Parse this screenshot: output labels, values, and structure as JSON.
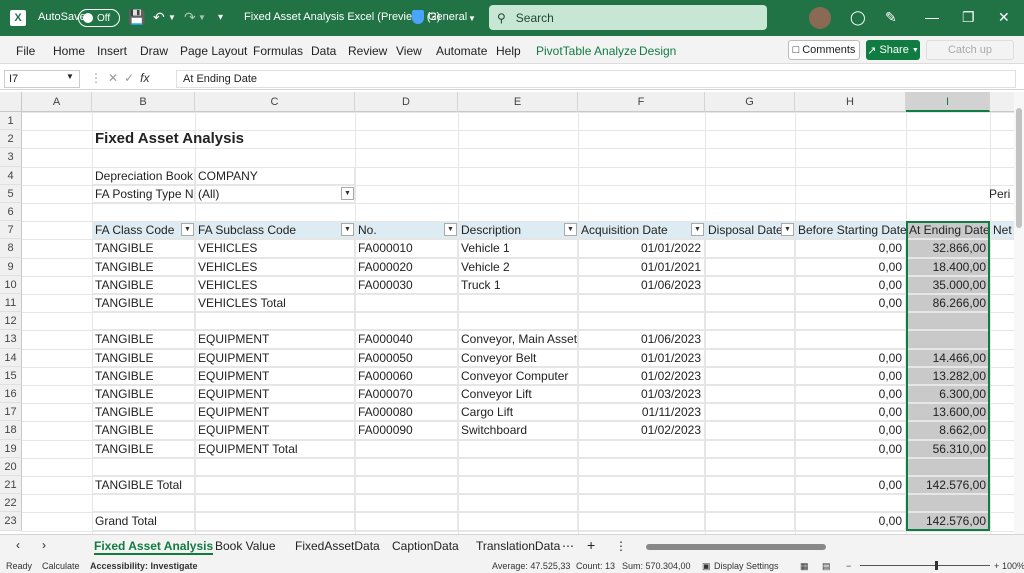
{
  "titlebar": {
    "app_icon": "excel-logo-icon",
    "autosave_label": "AutoSave",
    "autosave_state": "Off",
    "doc_title": "Fixed Asset Analysis Excel (Preview) (2)",
    "sensitivity": "General",
    "search_placeholder": "Search"
  },
  "menu": {
    "items": [
      "File",
      "Home",
      "Insert",
      "Draw",
      "Page Layout",
      "Formulas",
      "Data",
      "Review",
      "View",
      "Automate",
      "Help",
      "PivotTable Analyze",
      "Design"
    ],
    "comments": "Comments",
    "share": "Share",
    "catch_up": "Catch up"
  },
  "formula_bar": {
    "name_box": "I7",
    "fx": "fx",
    "content": "At Ending Date"
  },
  "columns": [
    "A",
    "B",
    "C",
    "D",
    "E",
    "F",
    "G",
    "H",
    "I"
  ],
  "rows": [
    "1",
    "2",
    "3",
    "4",
    "5",
    "6",
    "7",
    "8",
    "9",
    "10",
    "11",
    "12",
    "13",
    "14",
    "15",
    "16",
    "17",
    "18",
    "19",
    "20",
    "21",
    "22",
    "23"
  ],
  "sheet": {
    "title": "Fixed Asset Analysis",
    "filters": [
      {
        "label": "Depreciation Book",
        "value": "COMPANY"
      },
      {
        "label": "FA Posting Type Na",
        "value": "(All)"
      }
    ],
    "period_label": "Peri",
    "headers": [
      "FA Class Code",
      "FA Subclass Code",
      "No.",
      "Description",
      "Acquisition Date",
      "Disposal Date",
      "Before Starting Date",
      "At Ending Date",
      "Net"
    ],
    "data_rows": [
      {
        "row": "8",
        "class": "TANGIBLE",
        "subclass": "VEHICLES",
        "no": "FA000010",
        "desc": "Vehicle 1",
        "acq": "01/01/2022",
        "disp": "",
        "before": "0,00",
        "end": "32.866,00"
      },
      {
        "row": "9",
        "class": "TANGIBLE",
        "subclass": "VEHICLES",
        "no": "FA000020",
        "desc": "Vehicle 2",
        "acq": "01/01/2021",
        "disp": "",
        "before": "0,00",
        "end": "18.400,00"
      },
      {
        "row": "10",
        "class": "TANGIBLE",
        "subclass": "VEHICLES",
        "no": "FA000030",
        "desc": "Truck 1",
        "acq": "01/06/2023",
        "disp": "",
        "before": "0,00",
        "end": "35.000,00"
      },
      {
        "row": "11",
        "class": "TANGIBLE",
        "subclass": "VEHICLES Total",
        "no": "",
        "desc": "",
        "acq": "",
        "disp": "",
        "before": "0,00",
        "end": "86.266,00"
      },
      {
        "row": "12",
        "class": "",
        "subclass": "",
        "no": "",
        "desc": "",
        "acq": "",
        "disp": "",
        "before": "",
        "end": ""
      },
      {
        "row": "13",
        "class": "TANGIBLE",
        "subclass": "EQUIPMENT",
        "no": "FA000040",
        "desc": "Conveyor, Main Asset",
        "acq": "01/06/2023",
        "disp": "",
        "before": "",
        "end": ""
      },
      {
        "row": "14",
        "class": "TANGIBLE",
        "subclass": "EQUIPMENT",
        "no": "FA000050",
        "desc": "Conveyor Belt",
        "acq": "01/01/2023",
        "disp": "",
        "before": "0,00",
        "end": "14.466,00"
      },
      {
        "row": "15",
        "class": "TANGIBLE",
        "subclass": "EQUIPMENT",
        "no": "FA000060",
        "desc": "Conveyor Computer",
        "acq": "01/02/2023",
        "disp": "",
        "before": "0,00",
        "end": "13.282,00"
      },
      {
        "row": "16",
        "class": "TANGIBLE",
        "subclass": "EQUIPMENT",
        "no": "FA000070",
        "desc": "Conveyor Lift",
        "acq": "01/03/2023",
        "disp": "",
        "before": "0,00",
        "end": "6.300,00"
      },
      {
        "row": "17",
        "class": "TANGIBLE",
        "subclass": "EQUIPMENT",
        "no": "FA000080",
        "desc": "Cargo Lift",
        "acq": "01/11/2023",
        "disp": "",
        "before": "0,00",
        "end": "13.600,00"
      },
      {
        "row": "18",
        "class": "TANGIBLE",
        "subclass": "EQUIPMENT",
        "no": "FA000090",
        "desc": "Switchboard",
        "acq": "01/02/2023",
        "disp": "",
        "before": "0,00",
        "end": "8.662,00"
      },
      {
        "row": "19",
        "class": "TANGIBLE",
        "subclass": "EQUIPMENT Total",
        "no": "",
        "desc": "",
        "acq": "",
        "disp": "",
        "before": "0,00",
        "end": "56.310,00"
      },
      {
        "row": "20",
        "class": "",
        "subclass": "",
        "no": "",
        "desc": "",
        "acq": "",
        "disp": "",
        "before": "",
        "end": ""
      },
      {
        "row": "21",
        "class": "TANGIBLE Total",
        "subclass": "",
        "no": "",
        "desc": "",
        "acq": "",
        "disp": "",
        "before": "0,00",
        "end": "142.576,00"
      },
      {
        "row": "22",
        "class": "",
        "subclass": "",
        "no": "",
        "desc": "",
        "acq": "",
        "disp": "",
        "before": "",
        "end": ""
      },
      {
        "row": "23",
        "class": "Grand Total",
        "subclass": "",
        "no": "",
        "desc": "",
        "acq": "",
        "disp": "",
        "before": "0,00",
        "end": "142.576,00"
      }
    ]
  },
  "sheet_tabs": [
    "Fixed Asset Analysis",
    "Book Value",
    "FixedAssetData",
    "CaptionData",
    "TranslationData"
  ],
  "active_tab": "Fixed Asset Analysis",
  "status": {
    "ready": "Ready",
    "calculate": "Calculate",
    "accessibility": "Accessibility: Investigate",
    "average": "Average: 47.525,33",
    "count": "Count: 13",
    "sum": "Sum: 570.304,00",
    "display_settings": "Display Settings",
    "zoom": "100%"
  },
  "colors": {
    "accent": "#217346",
    "green_text": "#107c41",
    "header_band": "#ddebf2",
    "selected_col": "#c9c9c9"
  }
}
